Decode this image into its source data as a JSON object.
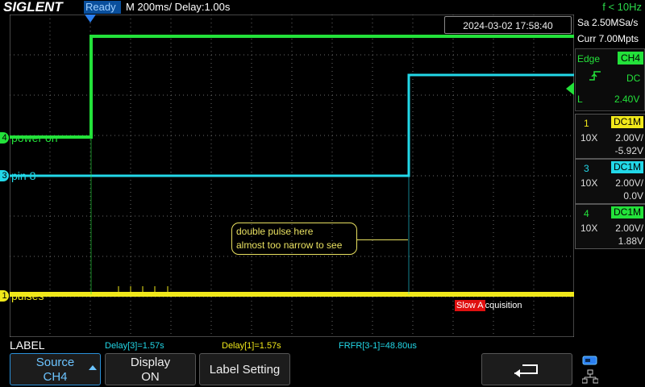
{
  "topbar": {
    "brand": "SIGLENT",
    "status": "Ready",
    "timebase": "M 200ms/  Delay:1.00s",
    "freq": "f < 10Hz"
  },
  "clock": "2024-03-02 17:58:40",
  "acquisition": {
    "sample_rate": "Sa 2.50MSa/s",
    "memory": "Curr 7.00Mpts"
  },
  "trigger": {
    "mode": "Edge",
    "source": "CH4",
    "coupling": "DC",
    "level_label": "L",
    "level": "2.40V"
  },
  "channels": [
    {
      "num": "1",
      "coupling": "DC1M",
      "probe": "10X",
      "scale": "2.00V/",
      "offset": "-5.92V",
      "color": "#f0e81a"
    },
    {
      "num": "3",
      "coupling": "DC1M",
      "probe": "10X",
      "scale": "2.00V/",
      "offset": "0.0V",
      "color": "#22d8e8"
    },
    {
      "num": "4",
      "coupling": "DC1M",
      "probe": "10X",
      "scale": "2.00V/",
      "offset": "1.88V",
      "color": "#23e23a"
    }
  ],
  "traces": {
    "ch4_label": "power on",
    "ch3_label": "pin 8",
    "ch1_label": "pulses",
    "ch4_marker": "4",
    "ch3_marker": "3",
    "ch1_marker": "1"
  },
  "annotation": {
    "line1": "double pulse here",
    "line2": "almost too narrow to see"
  },
  "slow_acq": {
    "prefix": "Slow A",
    "suffix": "cquisition"
  },
  "measurements": {
    "label": "LABEL",
    "delay3": "Delay[3]=1.57s",
    "delay1": "Delay[1]=1.57s",
    "frfr": "FRFR[3-1]=48.80us"
  },
  "softkeys": {
    "source_line1": "Source",
    "source_line2": "CH4",
    "display_line1": "Display",
    "display_line2": "ON",
    "label_setting": "Label Setting",
    "back_glyph": "⮐"
  },
  "colors": {
    "ch1": "#f0e81a",
    "ch3": "#22d8e8",
    "ch4": "#23e23a",
    "accent_blue": "#0a4f9c",
    "slow_red": "#e01010"
  }
}
